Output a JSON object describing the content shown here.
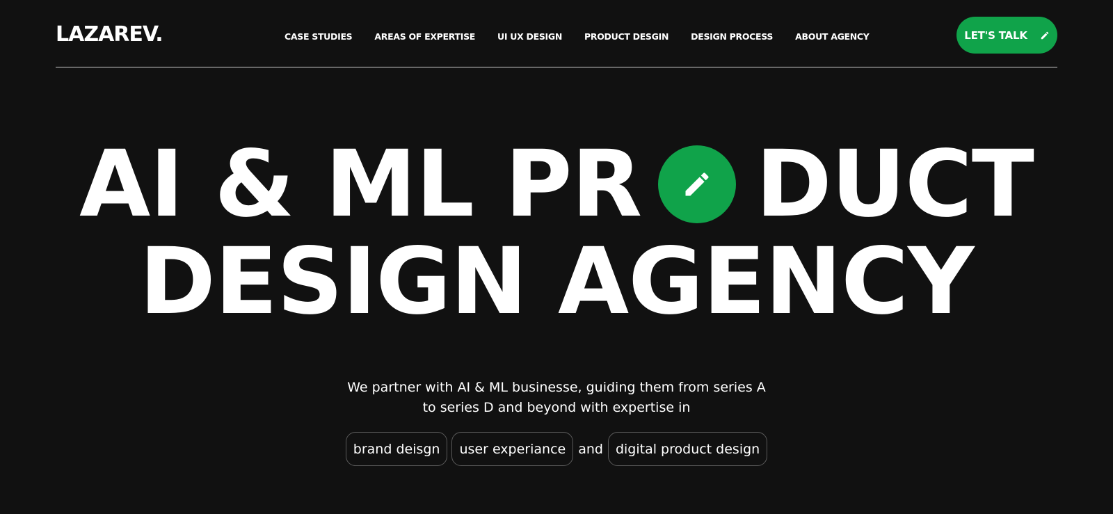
{
  "header": {
    "logo": "LAZAREV.",
    "nav": [
      "CASE STUDIES",
      "AREAS OF EXPERTISE",
      "UI UX DESIGN",
      "PRODUCT DESGIN",
      "DESIGN PROCESS",
      "ABOUT AGENCY"
    ],
    "cta_label": "LET'S TALK",
    "cta_icon": "pencil-icon"
  },
  "hero": {
    "line1_a": "AI & ML PR",
    "line1_b": "DUCT",
    "line2": "DESIGN AGENCY",
    "o_icon": "pencil-icon"
  },
  "intro": {
    "line1": "We partner with AI & ML businesse, guiding them from series A",
    "line2": "to series D and beyond with expertise in"
  },
  "expertise": {
    "chip1": "brand deisgn",
    "chip2": "user experiance",
    "connector": "and",
    "chip3": "digital product design"
  },
  "colors": {
    "background": "#111111",
    "accent": "#10a34a",
    "text": "#ffffff"
  }
}
